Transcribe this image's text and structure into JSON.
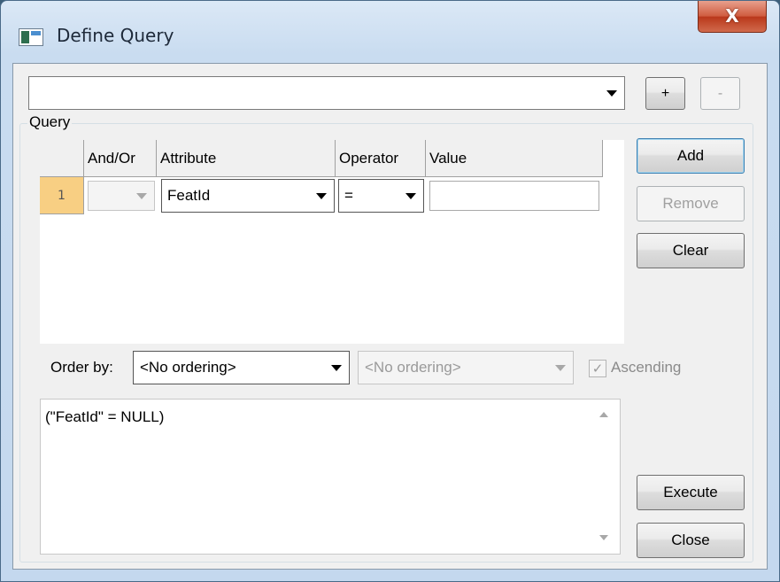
{
  "window": {
    "title": "Define Query",
    "close_label": "X"
  },
  "toolbar": {
    "query_select_value": "",
    "add_query_label": "+",
    "remove_query_label": "-"
  },
  "query_group": {
    "label": "Query",
    "columns": [
      "And/Or",
      "Attribute",
      "Operator",
      "Value"
    ],
    "rows": [
      {
        "index": "1",
        "and_or": "",
        "attribute": "FeatId",
        "operator": "=",
        "value": ""
      }
    ]
  },
  "side_buttons": {
    "add": "Add",
    "remove": "Remove",
    "clear": "Clear"
  },
  "order": {
    "label": "Order by:",
    "primary": "<No ordering>",
    "secondary": "<No ordering>",
    "ascending_label": "Ascending",
    "ascending_checked": true
  },
  "expression": {
    "text": "(\"FeatId\" = NULL)"
  },
  "bottom_buttons": {
    "execute": "Execute",
    "close": "Close"
  }
}
